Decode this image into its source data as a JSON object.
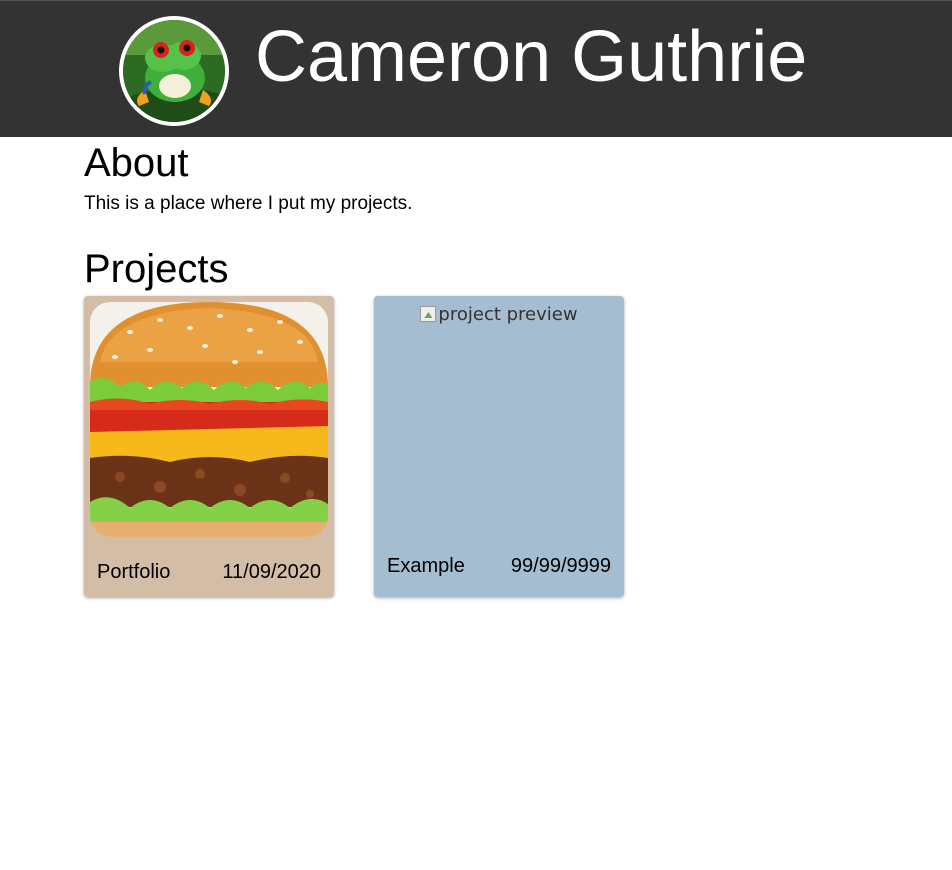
{
  "header": {
    "name": "Cameron Guthrie",
    "avatar_icon": "frog-avatar-icon"
  },
  "about": {
    "heading": "About",
    "text": "This is a place where I put my projects."
  },
  "projects": {
    "heading": "Projects",
    "items": [
      {
        "name": "Portfolio",
        "date": "11/09/2020",
        "image": "burger-image",
        "background": "#d3bda6"
      },
      {
        "name": "Example",
        "date": "99/99/9999",
        "image_alt": "project preview",
        "background": "#a4bdd1"
      }
    ]
  },
  "colors": {
    "header_bg": "#333333",
    "header_text": "#ffffff"
  }
}
